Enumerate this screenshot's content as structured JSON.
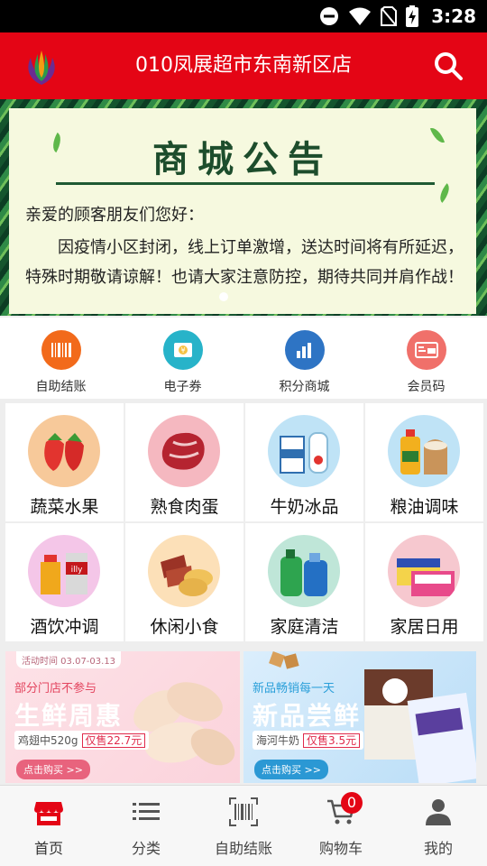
{
  "status_bar": {
    "time": "3:28"
  },
  "header": {
    "title": "010凤展超市东南新区店",
    "brand_color": "#e40515"
  },
  "banner": {
    "title": "商城公告",
    "greeting": "亲爱的顾客朋友们您好：",
    "body": "因疫情小区封闭，线上订单激增，送达时间将有所延迟，特殊时期敬请谅解！也请大家注意防控，期待共同并肩作战！"
  },
  "quick_actions": [
    {
      "label": "自助结账",
      "icon": "barcode-icon",
      "color": "#f26a1b"
    },
    {
      "label": "电子券",
      "icon": "coupon-icon",
      "color": "#27b3c9"
    },
    {
      "label": "积分商城",
      "icon": "chart-bar-icon",
      "color": "#2e74c4"
    },
    {
      "label": "会员码",
      "icon": "vip-card-icon",
      "color": "#f0706a"
    }
  ],
  "categories": [
    {
      "label": "蔬菜水果",
      "icon": "strawberry-icon"
    },
    {
      "label": "熟食肉蛋",
      "icon": "steak-icon"
    },
    {
      "label": "牛奶冰品",
      "icon": "milk-icon"
    },
    {
      "label": "粮油调味",
      "icon": "oil-rice-icon"
    },
    {
      "label": "酒饮冲调",
      "icon": "honey-coffee-icon"
    },
    {
      "label": "休闲小食",
      "icon": "snack-icon"
    },
    {
      "label": "家庭清洁",
      "icon": "detergent-icon"
    },
    {
      "label": "家居日用",
      "icon": "tissue-icon"
    }
  ],
  "promos": [
    {
      "tag": "活动时间 03.07-03.13",
      "subtitle": "部分门店不参与",
      "title": "生鲜周惠",
      "product": "鸡翅中520g",
      "price": "仅售22.7元",
      "button": "点击购买 >>"
    },
    {
      "tag": "",
      "subtitle": "新品畅销每一天",
      "title": "新品尝鲜",
      "product": "海河牛奶",
      "price": "仅售3.5元",
      "button": "点击购买 >>"
    }
  ],
  "tabbar": {
    "items": [
      {
        "label": "首页",
        "icon": "store-icon",
        "active": true
      },
      {
        "label": "分类",
        "icon": "list-icon",
        "active": false
      },
      {
        "label": "自助结账",
        "icon": "barcode-scan-icon",
        "active": false
      },
      {
        "label": "购物车",
        "icon": "cart-icon",
        "active": false
      },
      {
        "label": "我的",
        "icon": "person-icon",
        "active": false
      }
    ],
    "cart_count": "0"
  }
}
